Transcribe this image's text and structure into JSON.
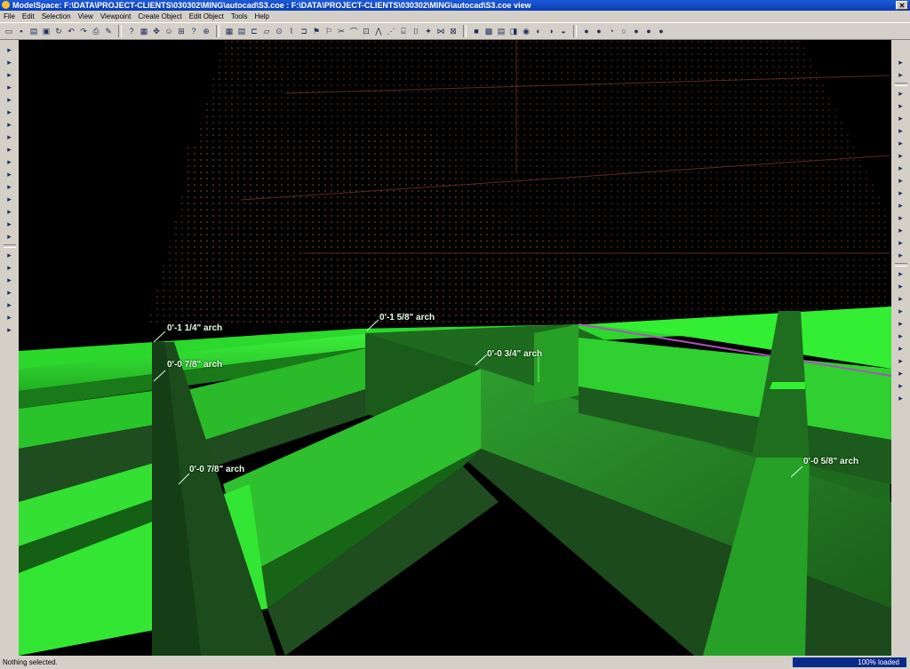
{
  "window": {
    "title": "ModelSpace: F:\\DATA\\PROJECT-CLIENTS\\030302\\MING\\autocad\\S3.coe : F:\\DATA\\PROJECT-CLIENTS\\030302\\MING\\autocad\\S3.coe view",
    "close_glyph": "✕"
  },
  "menu": [
    "File",
    "Edit",
    "Selection",
    "View",
    "Viewpoint",
    "Create Object",
    "Edit Object",
    "Tools",
    "Help"
  ],
  "toolbar_icons": [
    "new-icon",
    "save-icon",
    "open-icon",
    "print-setup-icon",
    "refresh-icon",
    "undo-icon",
    "redo-icon",
    "print-icon",
    "pencil-icon",
    "|",
    "query-icon",
    "select-icon",
    "move-icon",
    "user-icon",
    "measure-icon",
    "help-icon",
    "zoom-icon",
    "|",
    "grid-icon",
    "table-icon",
    "beam-icon",
    "plate-icon",
    "bolt-icon",
    "weld-icon",
    "section-icon",
    "flag-icon",
    "flag2-icon",
    "cut-icon",
    "bend-icon",
    "frame-icon",
    "truss-icon",
    "brace-icon",
    "stair-icon",
    "rail-icon",
    "joint-icon",
    "connect-icon",
    "fit-icon",
    "|",
    "box-icon",
    "solid-icon",
    "layer-icon",
    "view-icon",
    "cam-icon",
    "render-icon",
    "color-icon",
    "shade-icon",
    "|",
    "dot1-icon",
    "dot2-icon",
    "dot3-icon",
    "dot4-icon",
    "dot5-icon",
    "dot6-icon",
    "dot7-icon"
  ],
  "left_tool_icons": [
    "select-arrow-icon",
    "layers-icon",
    "rotate-icon",
    "pan-icon",
    "zoom-z-icon",
    "member-icon",
    "column-icon",
    "beam-tool-icon",
    "brace-tool-icon",
    "plate-tool-icon",
    "bolt-tool-icon",
    "weld-tool-icon",
    "text-icon",
    "dim-icon",
    "cut-tool-icon",
    "sphere-icon",
    "sep",
    "pan2-icon",
    "grid2-icon",
    "frame2-icon",
    "connect2-icon",
    "view2-icon",
    "wire-icon",
    "shade2-icon"
  ],
  "right_tool_icons": [
    "snap1-icon",
    "snap2-icon",
    "sep",
    "snap3-icon",
    "snap4-icon",
    "snap5-icon",
    "snap6-icon",
    "snap7-icon",
    "snap8-icon",
    "snap9-icon",
    "snap10-icon",
    "snap11-icon",
    "snap12-icon",
    "snap13-icon",
    "snap14-icon",
    "snap15-icon",
    "snap16-icon",
    "sep",
    "snap17-icon",
    "snap18-icon",
    "snap19-icon",
    "snap20-icon",
    "snap21-icon",
    "snap22-icon",
    "snap23-icon",
    "snap24-icon",
    "snap25-icon",
    "snap26-icon",
    "snap27-icon"
  ],
  "dimensions": [
    "0'-1 1/4\" arch",
    "0'-0 7/8\" arch",
    "0'-1 5/8\" arch",
    "0'-0 3/4\" arch",
    "0'-0 7/8\" arch",
    "0'-0 5/8\" arch"
  ],
  "status": {
    "message": "Nothing selected.",
    "progress_text": "100% loaded",
    "progress_value": 1.0
  },
  "colors": {
    "steel_bright": "#33ee33",
    "steel_mid": "#1fa81f",
    "steel_dark": "#1f4d1f",
    "background": "#000000",
    "grid_dots": "#7a3a3a"
  }
}
